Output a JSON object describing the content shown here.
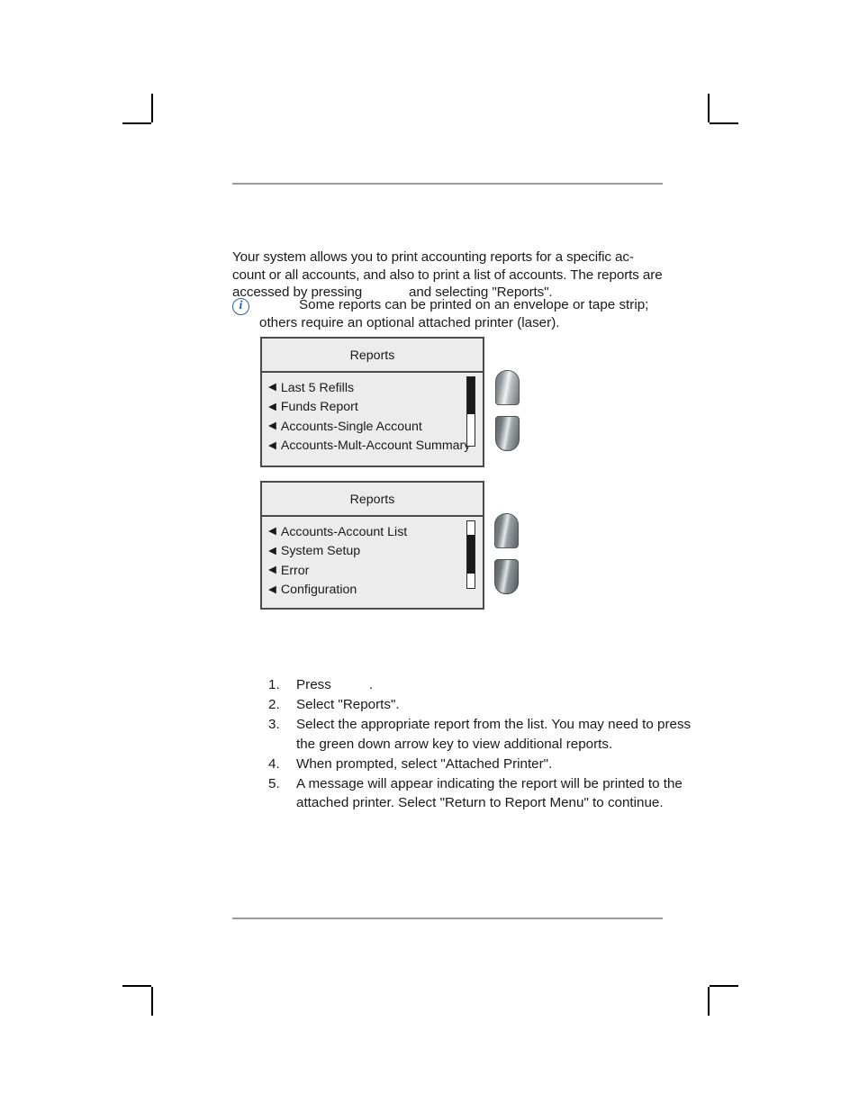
{
  "document": {
    "intro": {
      "part1": "Your system allows you to print accounting reports for a specific ac-count or all accounts, and also to print a list of accounts. The reports are accessed by pressing",
      "part2": "and selecting \"Reports\"."
    },
    "note": {
      "icon": "info-icon",
      "icon_glyph": "i",
      "text": "Some reports can be printed on an envelope or tape strip; others require an optional attached printer (laser)."
    },
    "panels": [
      {
        "title": "Reports",
        "items": [
          "Last 5 Refills",
          "Funds Report",
          "Accounts-Single Account",
          "Accounts-Mult-Account Summary"
        ],
        "arrow_glyph": "◀",
        "scrollbar": {
          "thumb_top_pct": 0,
          "thumb_height_pct": 54
        }
      },
      {
        "title": "Reports",
        "items": [
          "Accounts-Account List",
          "System Setup",
          "Error",
          "Configuration"
        ],
        "arrow_glyph": "◀",
        "scrollbar": {
          "thumb_top_pct": 20,
          "thumb_height_pct": 58
        }
      }
    ],
    "keypads": [
      {
        "up_label": "up-arrow-key",
        "down_label": "down-arrow-key"
      },
      {
        "up_label": "up-arrow-key",
        "down_label": "down-arrow-key"
      }
    ],
    "steps": [
      {
        "num": "1.",
        "text_before": "Press",
        "text_after": ".",
        "has_gap": true
      },
      {
        "num": "2.",
        "text": "Select \"Reports\"."
      },
      {
        "num": "3.",
        "text": "Select the appropriate report from the list. You may need to press the green down arrow key to view additional reports."
      },
      {
        "num": "4.",
        "text": "When prompted, select \"Attached Printer\"."
      },
      {
        "num": "5.",
        "text": "A message will appear indicating the report will be printed to the attached printer. Select \"Return to Report Menu\" to continue."
      }
    ],
    "colors": {
      "rule": "#9a9a9a",
      "panel_border": "#4a4a4a",
      "panel_bg": "#ececec",
      "info_blue": "#2b5fa8",
      "text": "#1a1a1a"
    }
  }
}
